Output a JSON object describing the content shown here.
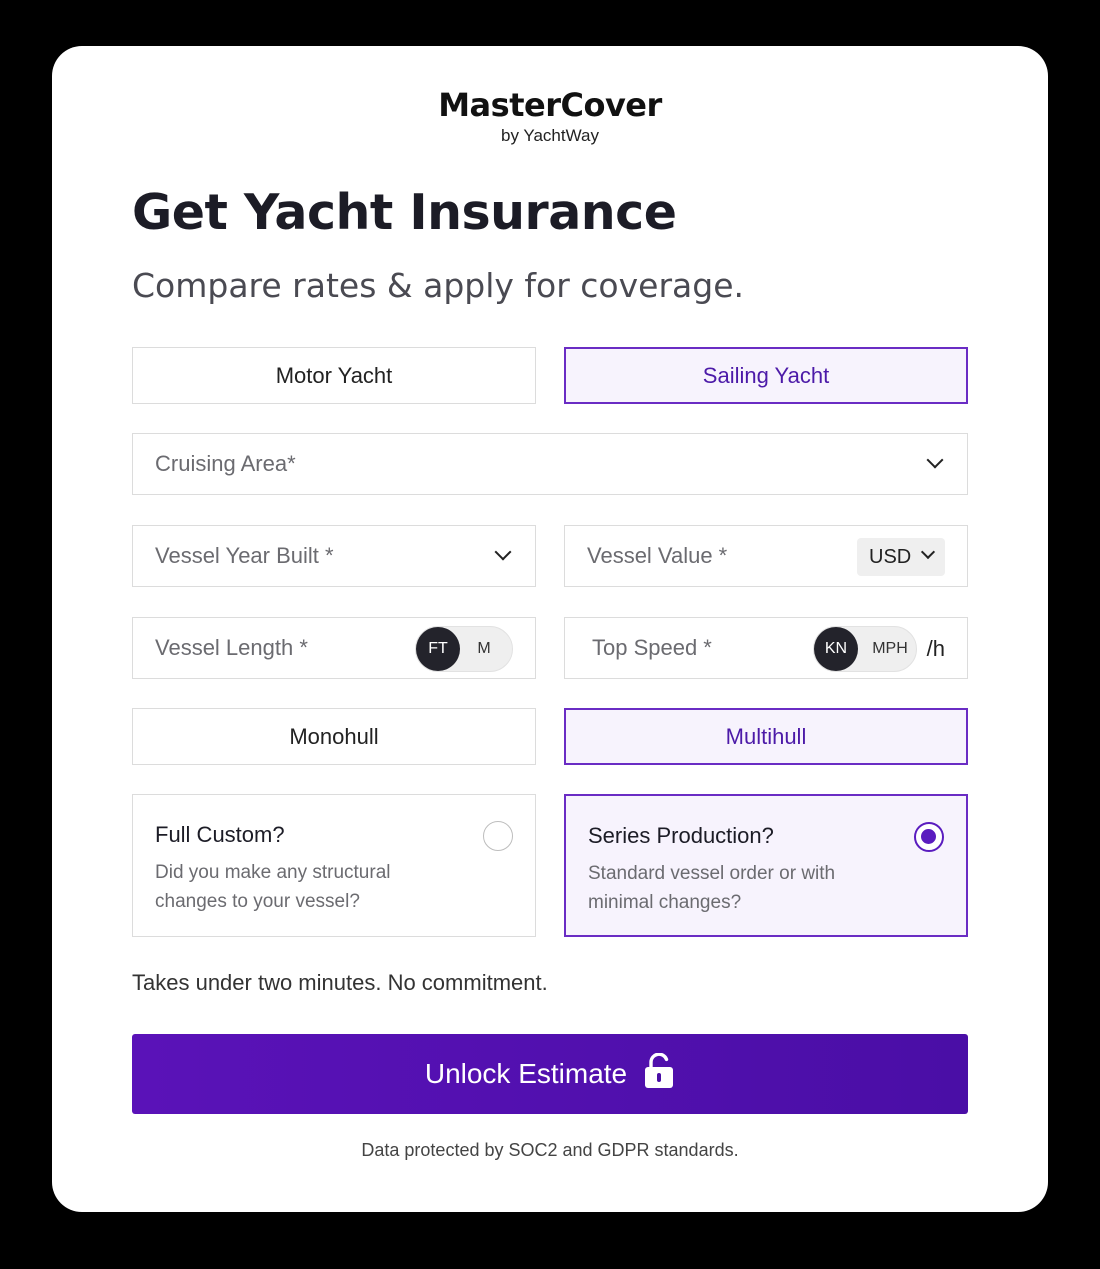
{
  "brand": {
    "name": "MasterCover",
    "tagline": "by YachtWay"
  },
  "header": {
    "title": "Get Yacht Insurance",
    "subtitle": "Compare rates & apply for coverage."
  },
  "yacht_type": {
    "options": [
      "Motor Yacht",
      "Sailing Yacht"
    ],
    "selected": "Sailing Yacht"
  },
  "fields": {
    "cruising_area": "Cruising Area*",
    "year_built": "Vessel Year Built *",
    "vessel_value": "Vessel Value *",
    "currency": "USD",
    "vessel_length": "Vessel Length *",
    "length_units": [
      "FT",
      "M"
    ],
    "length_unit_selected": "FT",
    "top_speed": "Top Speed *",
    "speed_units": [
      "KN",
      "MPH"
    ],
    "speed_unit_selected": "KN",
    "speed_suffix": "/h"
  },
  "hull_type": {
    "options": [
      "Monohull",
      "Multihull"
    ],
    "selected": "Multihull"
  },
  "build_type": {
    "options": [
      {
        "title": "Full Custom?",
        "desc": "Did you make any structural changes to your vessel?",
        "checked": false
      },
      {
        "title": "Series Production?",
        "desc": "Standard vessel order or with minimal changes?",
        "checked": true
      }
    ]
  },
  "note": "Takes under two minutes. No commitment.",
  "cta": {
    "label": "Unlock Estimate",
    "icon": "unlock-icon"
  },
  "footer": "Data protected by SOC2 and GDPR standards.",
  "colors": {
    "accent": "#5a12b8",
    "accent_light": "#f7f3fd",
    "border": "#dcdcdc"
  }
}
